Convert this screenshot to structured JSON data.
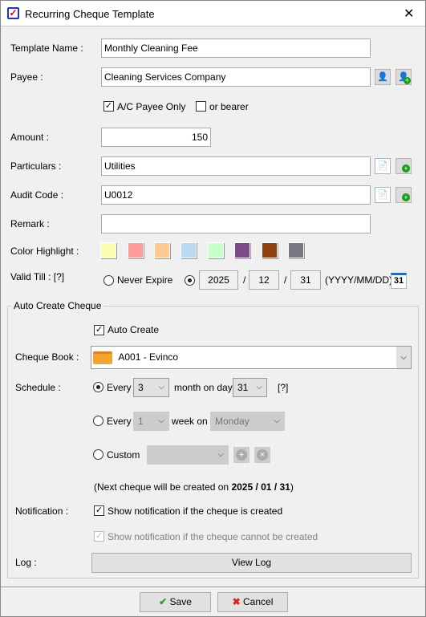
{
  "window": {
    "title": "Recurring Cheque Template",
    "close": "✕"
  },
  "form": {
    "template_name_label": "Template Name :",
    "template_name": "Monthly Cleaning Fee",
    "payee_label": "Payee :",
    "payee": "Cleaning Services Company",
    "ac_payee_only": "A/C Payee Only",
    "ac_payee_only_checked": true,
    "or_bearer": "or bearer",
    "or_bearer_checked": false,
    "amount_label": "Amount :",
    "amount": "150",
    "particulars_label": "Particulars :",
    "particulars": "Utilities",
    "audit_code_label": "Audit Code :",
    "audit_code": "U0012",
    "remark_label": "Remark :",
    "remark": "",
    "color_highlight_label": "Color Highlight :",
    "colors": [
      "#fdfdb4",
      "#ff9b9b",
      "#ffc993",
      "#bbdaf6",
      "#c9ffcb",
      "#7b4c87",
      "#8e410e",
      "#78777f"
    ],
    "valid_till_label": "Valid Till : [?]",
    "never_expire": "Never Expire",
    "year": "2025",
    "month": "12",
    "day": "31",
    "sep": "/",
    "date_format": "(YYYY/MM/DD)",
    "calendar_icon_text": "31"
  },
  "auto": {
    "group_title": "Auto Create Cheque",
    "auto_create": "Auto Create",
    "cheque_book_label": "Cheque Book :",
    "cheque_book": "A001 - Evinco",
    "schedule_label": "Schedule :",
    "every": "Every",
    "month_interval": "3",
    "month_on_day": "month on day",
    "month_day": "31",
    "help": "[?]",
    "week_interval": "1",
    "week_on": "week on",
    "weekday": "Monday",
    "custom": "Custom",
    "custom_value": "",
    "next_prefix": "(Next cheque will be created on ",
    "next_date": "2025 / 01 / 31",
    "next_suffix": ")",
    "notification_label": "Notification :",
    "notify_created": "Show notification if the cheque is created",
    "notify_failed": "Show notification if the cheque cannot be created",
    "log_label": "Log :",
    "view_log": "View Log"
  },
  "footer": {
    "save": "Save",
    "cancel": "Cancel"
  }
}
